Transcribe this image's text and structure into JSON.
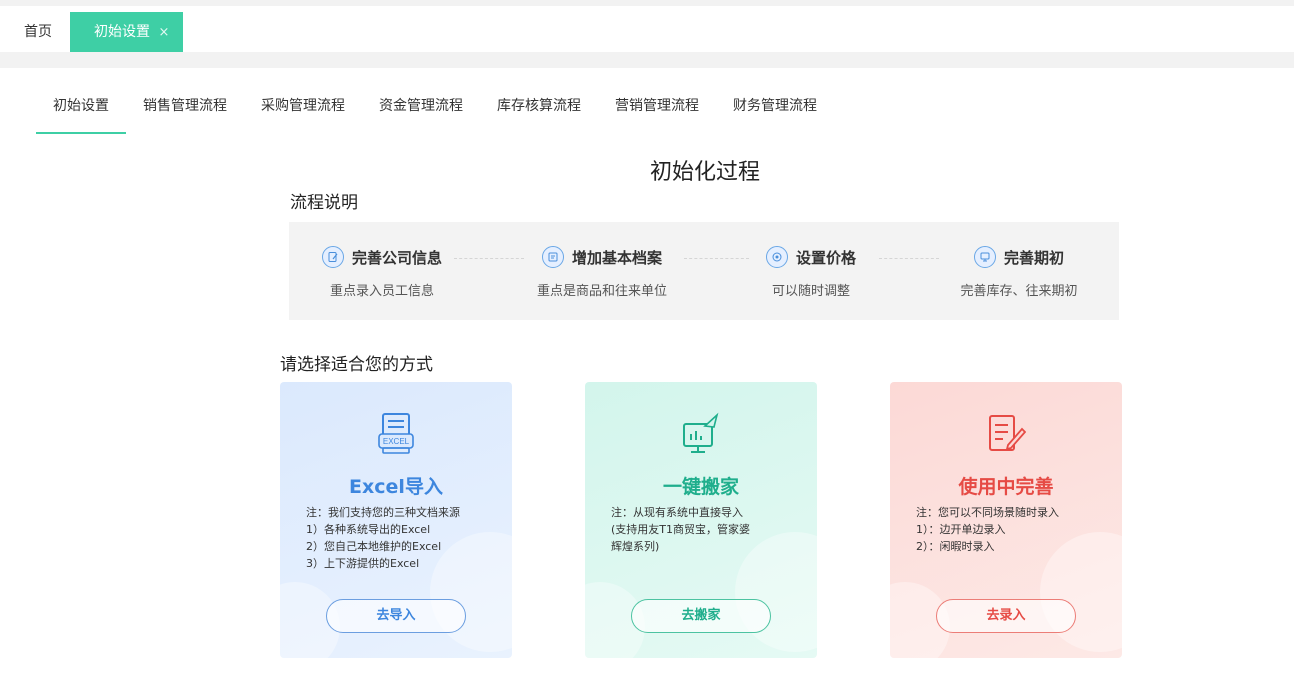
{
  "tabs": {
    "home_label": "首页",
    "active_label": "初始设置",
    "close_glyph": "×"
  },
  "subnav": {
    "items": [
      "初始设置",
      "销售管理流程",
      "采购管理流程",
      "资金管理流程",
      "库存核算流程",
      "营销管理流程",
      "财务管理流程"
    ]
  },
  "main": {
    "title": "初始化过程",
    "flow_title": "流程说明",
    "choose_title": "请选择适合您的方式"
  },
  "steps": [
    {
      "name": "完善公司信息",
      "desc": "重点录入员工信息",
      "icon": "edit-icon"
    },
    {
      "name": "增加基本档案",
      "desc": "重点是商品和往来单位",
      "icon": "archive-icon"
    },
    {
      "name": "设置价格",
      "desc": "可以随时调整",
      "icon": "price-icon"
    },
    {
      "name": "完善期初",
      "desc": "完善库存、往来期初",
      "icon": "balance-icon"
    }
  ],
  "options": {
    "excel": {
      "title": "Excel导入",
      "notes": [
        "注：我们支持您的三种文档来源",
        "1）各种系统导出的Excel",
        "2）您自己本地维护的Excel",
        "3）上下游提供的Excel"
      ],
      "button": "去导入",
      "icon_text": "EXCEL",
      "color": "#3d86de"
    },
    "move": {
      "title": "一键搬家",
      "notes": [
        "注：从现有系统中直接导入",
        "(支持用友T1商贸宝，管家婆",
        "辉煌系列)"
      ],
      "button": "去搬家",
      "color": "#1fae8c"
    },
    "fill": {
      "title": "使用中完善",
      "notes": [
        "注：您可以不同场景随时录入",
        "1）：边开单边录入",
        "2）：闲暇时录入"
      ],
      "button": "去录入",
      "color": "#e64b45"
    }
  },
  "colors": {
    "accent": "#3ecfa5"
  }
}
